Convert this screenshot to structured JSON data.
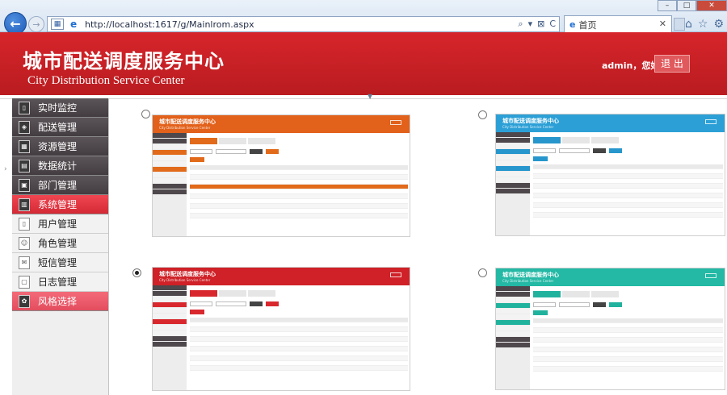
{
  "browser": {
    "url": "http://localhost:1617/g/Mainlrom.aspx",
    "tab_title": "首页",
    "compat_icon": "compat-view-icon",
    "address_tools": [
      "⌕",
      "▾",
      "⊠",
      "C"
    ]
  },
  "header": {
    "title_cn": "城市配送调度服务中心",
    "title_en": "City Distribution Service Center",
    "greeting": "admin，您好！",
    "logout_label": "退 出"
  },
  "sidebar": {
    "items": [
      {
        "label": "实时监控",
        "icon": "monitor-icon",
        "glyph": "▯"
      },
      {
        "label": "配送管理",
        "icon": "delivery-icon",
        "glyph": "◈"
      },
      {
        "label": "资源管理",
        "icon": "resource-icon",
        "glyph": "▦"
      },
      {
        "label": "数据统计",
        "icon": "stats-icon",
        "glyph": "▤"
      },
      {
        "label": "部门管理",
        "icon": "department-icon",
        "glyph": "▣"
      },
      {
        "label": "系统管理",
        "icon": "system-icon",
        "glyph": "▥"
      },
      {
        "label": "用户管理",
        "icon": "user-icon",
        "glyph": "▯"
      },
      {
        "label": "角色管理",
        "icon": "role-icon",
        "glyph": "☺"
      },
      {
        "label": "短信管理",
        "icon": "sms-icon",
        "glyph": "✉"
      },
      {
        "label": "日志管理",
        "icon": "log-icon",
        "glyph": "▢"
      },
      {
        "label": "风格选择",
        "icon": "theme-icon",
        "glyph": "✿"
      }
    ]
  },
  "themes": [
    {
      "name": "orange",
      "selected": false,
      "header_color": "#e2611b",
      "accent": "#e26b1b",
      "title": "城市配送调度服务中心",
      "subtitle": "City Distribution Service Center"
    },
    {
      "name": "blue",
      "selected": false,
      "header_color": "#2ca0d6",
      "accent": "#2696cc",
      "title": "城市配送调度服务中心",
      "subtitle": "City Distribution Service Center"
    },
    {
      "name": "red",
      "selected": true,
      "header_color": "#cf2127",
      "accent": "#d8282e",
      "title": "城市配送调度服务中心",
      "subtitle": "City Distribution Service Center"
    },
    {
      "name": "teal",
      "selected": false,
      "header_color": "#23b9a5",
      "accent": "#21b29d",
      "title": "城市配送调度服务中心",
      "subtitle": "City Distribution Service Center"
    }
  ],
  "colors": {
    "header_red": "#cf2127",
    "sidebar_dark": "#4e474b",
    "sidebar_active": "#e2353f",
    "sidebar_selected": "#ec5d6c"
  }
}
